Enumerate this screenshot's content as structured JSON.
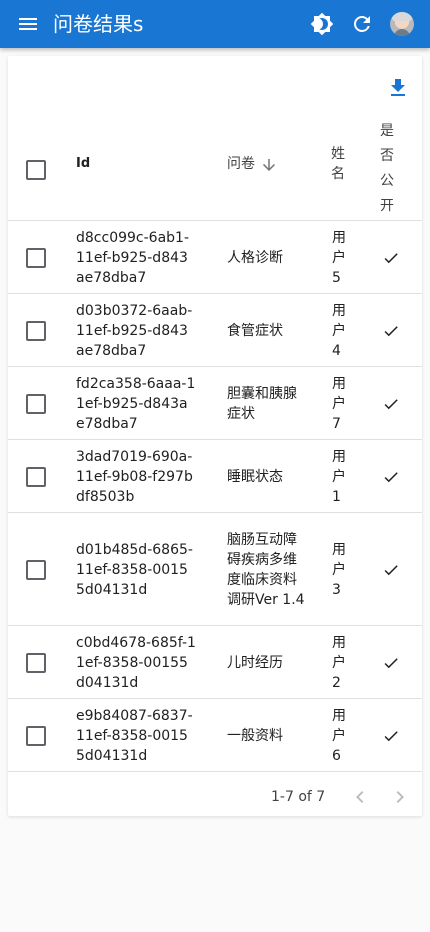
{
  "app": {
    "title": "问卷结果s",
    "brand_color": "#1976d2",
    "icons": [
      "menu-icon",
      "brightness-icon",
      "refresh-icon",
      "avatar"
    ]
  },
  "table": {
    "headers": {
      "id": "Id",
      "survey": "问卷",
      "user": "姓名",
      "public": "是否公开"
    },
    "rows": [
      {
        "id": "d8cc099c-6ab1-11ef-b925-d843ae78dba7",
        "survey": "人格诊断",
        "user": "用户5",
        "public": true
      },
      {
        "id": "d03b0372-6aab-11ef-b925-d843ae78dba7",
        "survey": "食管症状",
        "user": "用户4",
        "public": true
      },
      {
        "id": "fd2ca358-6aaa-11ef-b925-d843ae78dba7",
        "survey": "胆囊和胰腺症状",
        "user": "用户7",
        "public": true
      },
      {
        "id": "3dad7019-690a-11ef-9b08-f297bdf8503b",
        "survey": "睡眠状态",
        "user": "用户1",
        "public": true
      },
      {
        "id": "d01b485d-6865-11ef-8358-00155d04131d",
        "survey": "脑肠互动障碍疾病多维度临床资料调研Ver 1.4",
        "user": "用户3",
        "public": true
      },
      {
        "id": "c0bd4678-685f-11ef-8358-00155d04131d",
        "survey": "儿时经历",
        "user": "用户2",
        "public": true
      },
      {
        "id": "e9b84087-6837-11ef-8358-00155d04131d",
        "survey": "一般资料",
        "user": "用户6",
        "public": true
      }
    ]
  },
  "pagination": {
    "label": "1-7 of 7"
  }
}
